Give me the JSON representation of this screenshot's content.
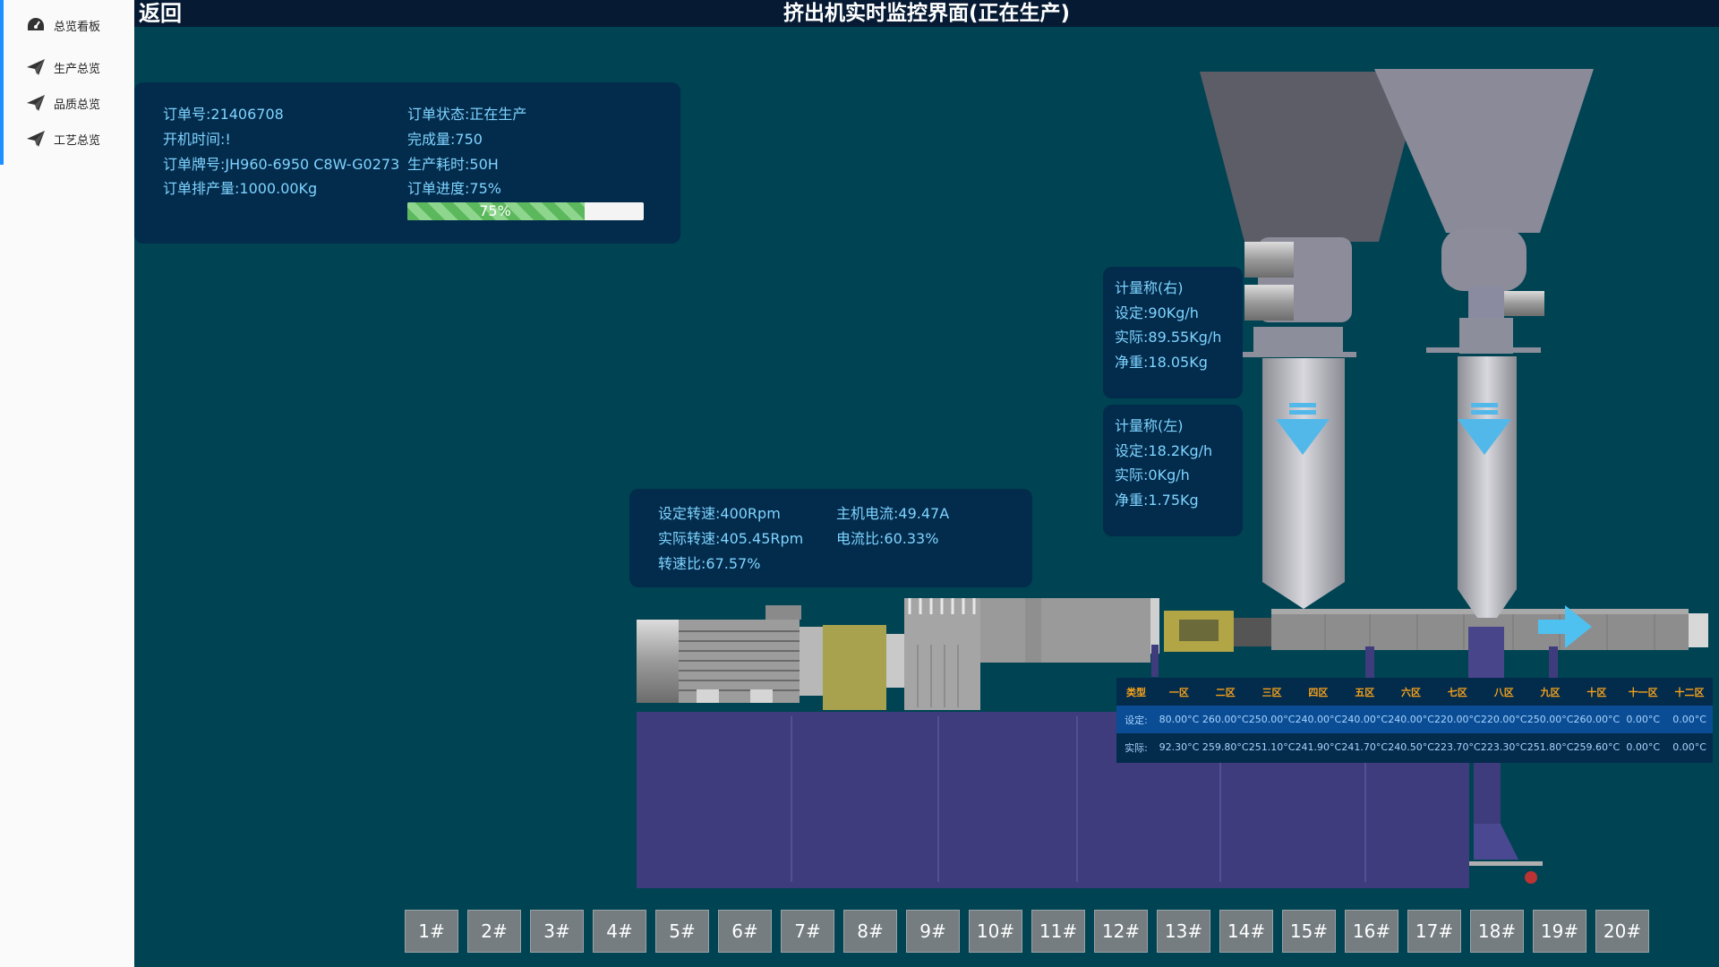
{
  "sidebar": {
    "items": [
      {
        "label": "总览看板",
        "icon": "dashboard-icon"
      },
      {
        "label": "生产总览",
        "icon": "paper-plane-icon"
      },
      {
        "label": "品质总览",
        "icon": "paper-plane-icon"
      },
      {
        "label": "工艺总览",
        "icon": "paper-plane-icon"
      }
    ]
  },
  "header": {
    "back": "返回",
    "title": "挤出机实时监控界面(正在生产)"
  },
  "order": {
    "order_no": "订单号:21406708",
    "start_time": "开机时间:!",
    "brand_no": "订单牌号:JH960-6950 C8W-G0273",
    "planned_qty": "订单排产量:1000.00Kg",
    "status": "订单状态:正在生产",
    "completed": "完成量:750",
    "time_used": "生产耗时:50H",
    "progress_label": "订单进度:75%",
    "progress_text": "75%",
    "progress_value": 0.75
  },
  "scale_right": {
    "title": "计量称(右)",
    "set": "设定:90Kg/h",
    "actual": "实际:89.55Kg/h",
    "net": "净重:18.05Kg"
  },
  "scale_left": {
    "title": "计量称(左)",
    "set": "设定:18.2Kg/h",
    "actual": "实际:0Kg/h",
    "net": "净重:1.75Kg"
  },
  "motor": {
    "set_speed": "设定转速:400Rpm",
    "actual_speed": "实际转速:405.45Rpm",
    "speed_ratio": "转速比:67.57%",
    "current": "主机电流:49.47A",
    "current_ratio": "电流比:60.33%"
  },
  "temps": {
    "headers": [
      "类型",
      "一区",
      "二区",
      "三区",
      "四区",
      "五区",
      "六区",
      "七区",
      "八区",
      "九区",
      "十区",
      "十一区",
      "十二区"
    ],
    "set": [
      "设定:",
      "80.00°C",
      "260.00°C",
      "250.00°C",
      "240.00°C",
      "240.00°C",
      "240.00°C",
      "220.00°C",
      "220.00°C",
      "250.00°C",
      "260.00°C",
      "0.00°C",
      "0.00°C"
    ],
    "actual": [
      "实际:",
      "92.30°C",
      "259.80°C",
      "251.10°C",
      "241.90°C",
      "241.70°C",
      "240.50°C",
      "223.70°C",
      "223.30°C",
      "251.80°C",
      "259.60°C",
      "0.00°C",
      "0.00°C"
    ]
  },
  "machines": [
    "1#",
    "2#",
    "3#",
    "4#",
    "5#",
    "6#",
    "7#",
    "8#",
    "9#",
    "10#",
    "11#",
    "12#",
    "13#",
    "14#",
    "15#",
    "16#",
    "17#",
    "18#",
    "19#",
    "20#"
  ],
  "colors": {
    "background": "#004352",
    "panel": "#032b4c",
    "accent": "#1e90ff",
    "text": "#7fd4ff",
    "header_temp": "#f6a21a"
  }
}
